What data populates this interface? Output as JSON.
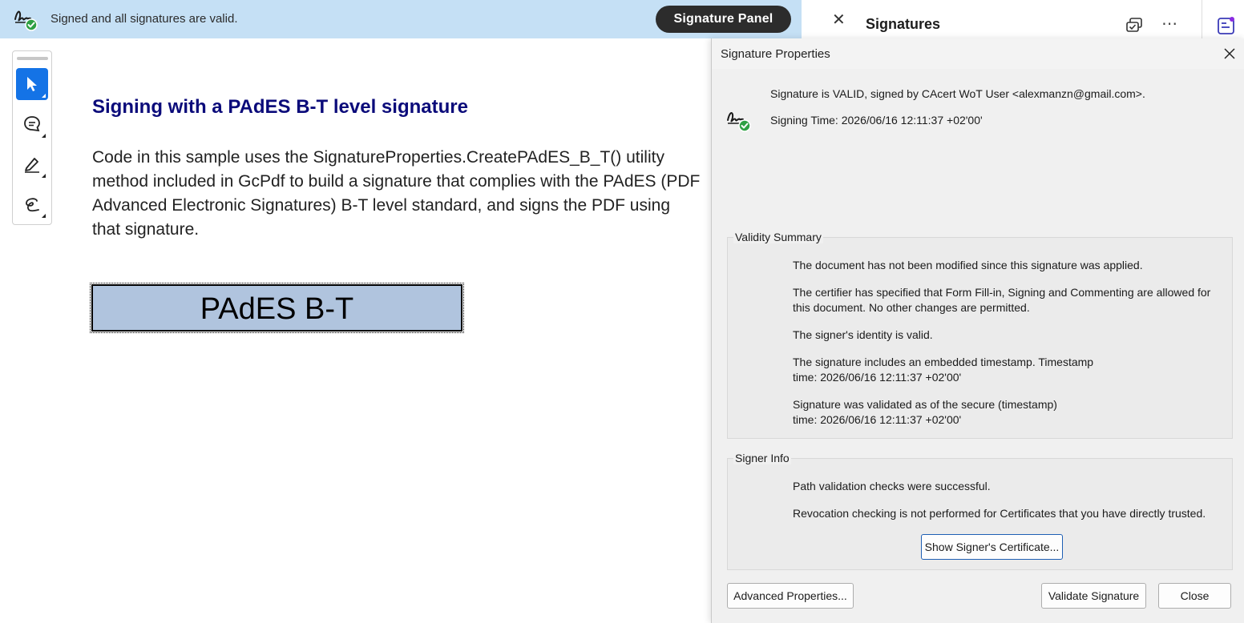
{
  "banner": {
    "message": "Signed and all signatures are valid.",
    "panel_button": "Signature Panel"
  },
  "signatures_panel": {
    "title": "Signatures"
  },
  "document": {
    "heading": "Signing with a PAdES B-T level signature",
    "body": "Code in this sample uses the SignatureProperties.CreatePAdES_B_T() utility method included in GcPdf to build a signature that complies with the PAdES (PDF Advanced Electronic Signatures) B-T level standard, and signs the PDF using that signature.",
    "signature_field_text": "PAdES B-T"
  },
  "dialog": {
    "title": "Signature Properties",
    "status_line": "Signature is VALID, signed by CAcert WoT User <alexmanzn@gmail.com>.",
    "signing_time": "Signing Time:  2026/06/16 12:11:37 +02'00'",
    "validity_summary": {
      "label": "Validity Summary",
      "items": [
        "The document has not been modified since this signature was applied.",
        "The certifier has specified that Form Fill-in, Signing and Commenting are allowed for this document. No other changes are permitted.",
        "The signer's identity is valid.",
        "The signature includes an embedded timestamp. Timestamp time: 2026/06/16 12:11:37 +02'00'",
        "Signature was validated as of the secure (timestamp) time: 2026/06/16 12:11:37 +02'00'"
      ]
    },
    "signer_info": {
      "label": "Signer Info",
      "items": [
        "Path validation checks were successful.",
        "Revocation checking is not performed for Certificates that you have directly trusted."
      ],
      "show_cert_button": "Show Signer's Certificate..."
    },
    "buttons": {
      "advanced": "Advanced Properties...",
      "validate": "Validate Signature",
      "close": "Close"
    }
  },
  "colors": {
    "banner_bg": "#c5e0f5",
    "accent": "#1473e6",
    "heading": "#0b0b7a",
    "signature_field": "#b0c4de",
    "valid_green": "#2ea043"
  }
}
